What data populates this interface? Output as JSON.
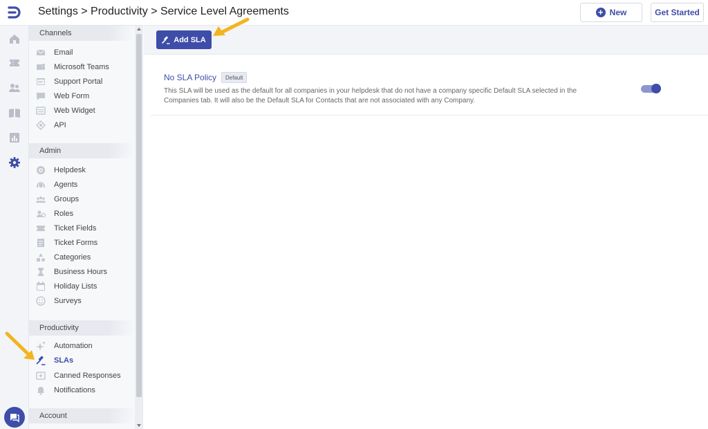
{
  "header": {
    "breadcrumb": "Settings > Productivity > Service Level Agreements",
    "new_label": "New",
    "get_started_label": "Get Started"
  },
  "rail": {
    "icons": [
      "logo-icon",
      "home-icon",
      "tickets-icon",
      "contacts-icon",
      "knowledge-base-icon",
      "reports-icon",
      "gear-icon",
      "chat-icon"
    ]
  },
  "sidebar": {
    "sections": [
      {
        "title": "Channels",
        "items": [
          {
            "label": "Email",
            "icon": "email-icon"
          },
          {
            "label": "Microsoft Teams",
            "icon": "teams-icon"
          },
          {
            "label": "Support Portal",
            "icon": "portal-icon"
          },
          {
            "label": "Web Form",
            "icon": "web-form-icon"
          },
          {
            "label": "Web Widget",
            "icon": "web-widget-icon"
          },
          {
            "label": "API",
            "icon": "api-icon"
          }
        ]
      },
      {
        "title": "Admin",
        "items": [
          {
            "label": "Helpdesk",
            "icon": "helpdesk-icon"
          },
          {
            "label": "Agents",
            "icon": "agents-icon"
          },
          {
            "label": "Groups",
            "icon": "groups-icon"
          },
          {
            "label": "Roles",
            "icon": "roles-icon"
          },
          {
            "label": "Ticket Fields",
            "icon": "ticket-fields-icon"
          },
          {
            "label": "Ticket Forms",
            "icon": "ticket-forms-icon"
          },
          {
            "label": "Categories",
            "icon": "categories-icon"
          },
          {
            "label": "Business Hours",
            "icon": "hourglass-icon"
          },
          {
            "label": "Holiday Lists",
            "icon": "calendar-icon"
          },
          {
            "label": "Surveys",
            "icon": "smiley-icon"
          }
        ]
      },
      {
        "title": "Productivity",
        "items": [
          {
            "label": "Automation",
            "icon": "sparkle-icon"
          },
          {
            "label": "SLAs",
            "icon": "gavel-icon",
            "active": true
          },
          {
            "label": "Canned Responses",
            "icon": "canned-response-icon"
          },
          {
            "label": "Notifications",
            "icon": "bell-icon"
          }
        ]
      },
      {
        "title": "Account",
        "items": []
      }
    ]
  },
  "main": {
    "add_button_label": "Add SLA",
    "policy": {
      "name": "No SLA Policy",
      "badge": "Default",
      "description": "This SLA will be used as the default for all companies in your helpdesk that do not have a company specific Default SLA selected in the Companies tab. It will also be the Default SLA for Contacts that are not associated with any Company.",
      "enabled": true
    }
  },
  "colors": {
    "accent": "#3e4da8",
    "arrow": "#f2b51f",
    "sidebar_bg": "#f7f8fa",
    "rail_bg": "#f3f4f7"
  }
}
